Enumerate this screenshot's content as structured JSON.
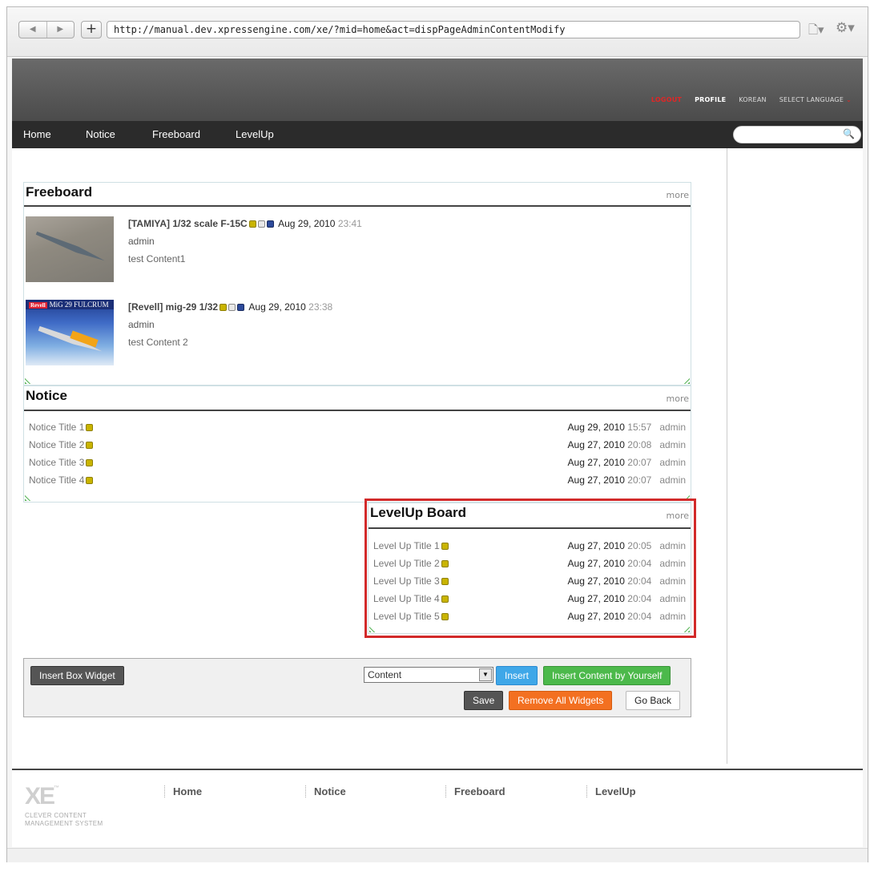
{
  "browser": {
    "url": "http://manual.dev.xpressengine.com/xe/?mid=home&act=dispPageAdminContentModify",
    "back_icon": "◀",
    "forward_icon": "▶",
    "newtab_icon": "+",
    "page_icon": "🗋▾",
    "gear_icon": "⚙▾"
  },
  "header": {
    "logout": "LOGOUT",
    "profile": "PROFILE",
    "korean": "KOREAN",
    "select_language": "SELECT LANGUAGE",
    "lang_arrow": "⌄"
  },
  "nav": {
    "items": [
      "Home",
      "Notice",
      "Freeboard",
      "LevelUp"
    ]
  },
  "search": {
    "placeholder": "",
    "icon": "🔍"
  },
  "freeboard": {
    "title": "Freeboard",
    "more": "more",
    "items": [
      {
        "title": "[TAMIYA] 1/32 scale F-15C",
        "date": "Aug 29, 2010",
        "time": "23:41",
        "author": "admin",
        "content": "test Content1"
      },
      {
        "title": "[Revell] mig-29 1/32",
        "date": "Aug 29, 2010",
        "time": "23:38",
        "author": "admin",
        "content": "test Content 2",
        "thumb_text": "MiG 29 FULCRUM",
        "thumb_brand": "Revell"
      }
    ]
  },
  "notice": {
    "title": "Notice",
    "more": "more",
    "rows": [
      {
        "title": "Notice Title 1",
        "date": "Aug 29, 2010",
        "time": "15:57",
        "author": "admin"
      },
      {
        "title": "Notice Title 2",
        "date": "Aug 27, 2010",
        "time": "20:08",
        "author": "admin"
      },
      {
        "title": "Notice Title 3",
        "date": "Aug 27, 2010",
        "time": "20:07",
        "author": "admin"
      },
      {
        "title": "Notice Title 4",
        "date": "Aug 27, 2010",
        "time": "20:07",
        "author": "admin"
      }
    ]
  },
  "levelup": {
    "title": "LevelUp Board",
    "more": "more",
    "rows": [
      {
        "title": "Level Up Title 1",
        "date": "Aug 27, 2010",
        "time": "20:05",
        "author": "admin"
      },
      {
        "title": "Level Up Title 2",
        "date": "Aug 27, 2010",
        "time": "20:04",
        "author": "admin"
      },
      {
        "title": "Level Up Title 3",
        "date": "Aug 27, 2010",
        "time": "20:04",
        "author": "admin"
      },
      {
        "title": "Level Up Title 4",
        "date": "Aug 27, 2010",
        "time": "20:04",
        "author": "admin"
      },
      {
        "title": "Level Up Title 5",
        "date": "Aug 27, 2010",
        "time": "20:04",
        "author": "admin"
      }
    ]
  },
  "admin": {
    "insert_box_widget": "Insert Box Widget",
    "content_select": "Content",
    "insert": "Insert",
    "insert_content_yourself": "Insert Content by Yourself",
    "save": "Save",
    "remove_all": "Remove All Widgets",
    "go_back": "Go Back"
  },
  "footer": {
    "logo": "XE",
    "logo_tm": "™",
    "tagline_1": "CLEVER CONTENT",
    "tagline_2": "MANAGEMENT SYSTEM",
    "links": [
      "Home",
      "Notice",
      "Freeboard",
      "LevelUp"
    ]
  },
  "colors": {
    "highlight": "#d22a2a",
    "insert_blue": "#3fa7e8",
    "insert_green": "#4cb94b",
    "remove_orange": "#f37021",
    "logout_red": "#e02626"
  }
}
